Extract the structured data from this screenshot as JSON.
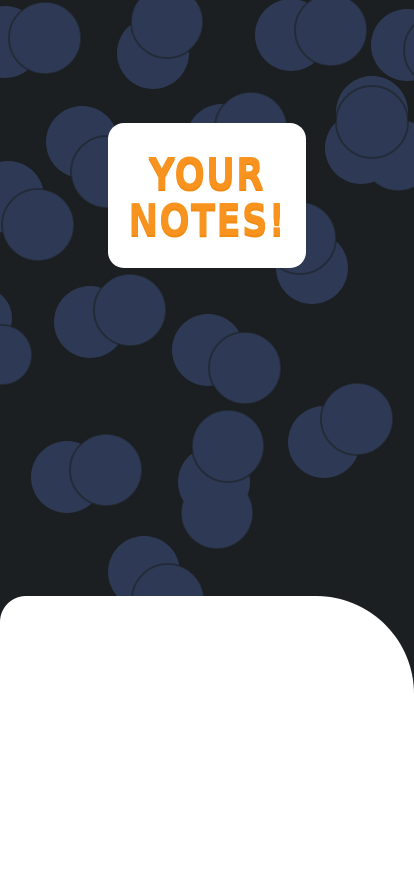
{
  "app": {
    "logo": {
      "line1": "YOUR",
      "line2": "NOTES!"
    }
  },
  "colors": {
    "background": "#1c1f21",
    "pattern_circle": "#2e3a55",
    "logo_card": "#ffffff",
    "logo_text": "#f7931e",
    "bottom_sheet": "#ffffff"
  },
  "icons": {
    "background": "overlapping-circles-pattern"
  },
  "bottom_sheet": {}
}
